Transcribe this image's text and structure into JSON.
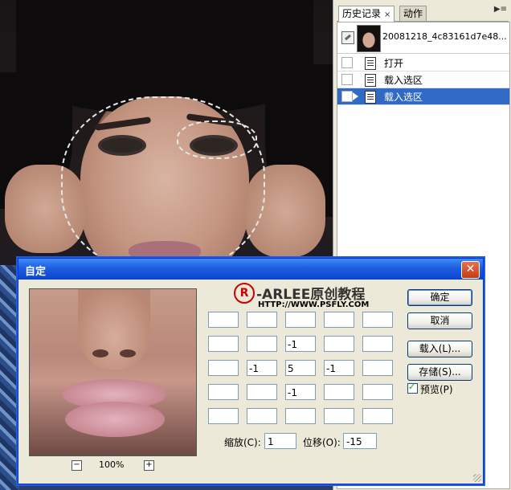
{
  "history": {
    "tabs": [
      {
        "label": "历史记录",
        "close": "×"
      },
      {
        "label": "动作"
      }
    ],
    "panel_menu": "▶≡",
    "snapshot_name": "20081218_4c83161d7e48...",
    "steps": [
      {
        "label": "打开"
      },
      {
        "label": "载入选区"
      },
      {
        "label": "载入选区"
      }
    ],
    "selected_step": 2
  },
  "dialog": {
    "title": "自定",
    "close": "✕",
    "zoom_out": "−",
    "zoom_in": "+",
    "zoom_level": "100%",
    "logo_mark": "R",
    "logo_text": "-ARLEE原创教程",
    "logo_url": "HTTP://WWW.PSFLY.COM",
    "matrix": [
      [
        "",
        "",
        "",
        "",
        ""
      ],
      [
        "",
        "",
        "-1",
        "",
        ""
      ],
      [
        "",
        "-1",
        "5",
        "-1",
        ""
      ],
      [
        "",
        "",
        "-1",
        "",
        ""
      ],
      [
        "",
        "",
        "",
        "",
        ""
      ]
    ],
    "scale_label": "缩放(C):",
    "scale_value": "1",
    "offset_label": "位移(O):",
    "offset_value": "-15",
    "buttons": {
      "ok": "确定",
      "cancel": "取消",
      "load": "载入(L)...",
      "save": "存储(S)..."
    },
    "preview_label": "预览(P)",
    "preview_checked": true
  }
}
